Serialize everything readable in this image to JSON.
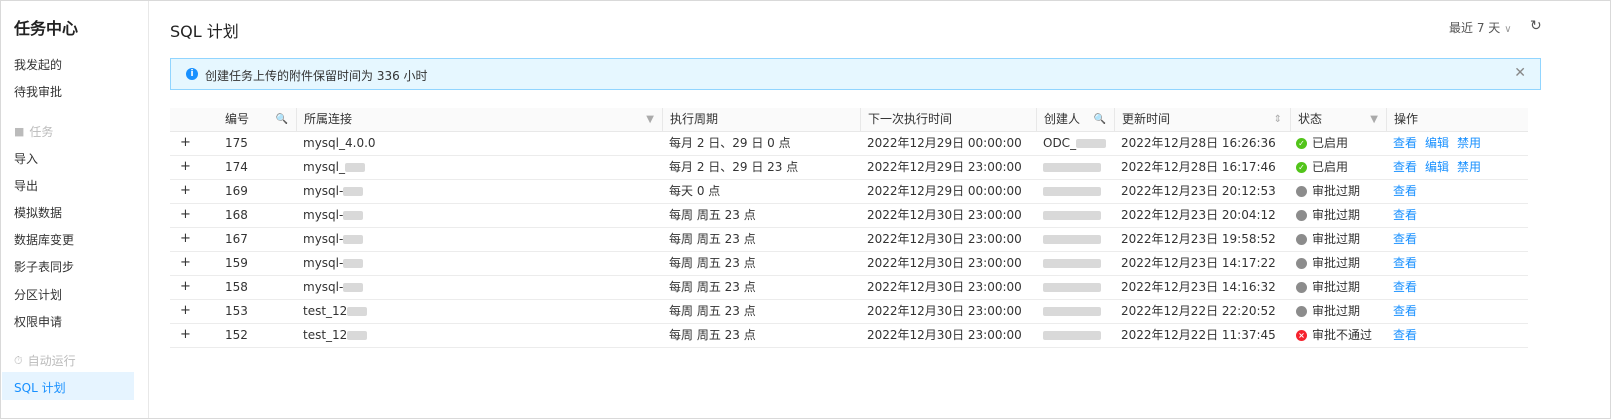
{
  "sidebar": {
    "title": "任务中心",
    "items_top": [
      "我发起的",
      "待我审批"
    ],
    "group_tasks": "任务",
    "task_items": [
      "导入",
      "导出",
      "模拟数据",
      "数据库变更",
      "影子表同步",
      "分区计划",
      "权限申请"
    ],
    "group_auto": "自动运行",
    "active_item": "SQL 计划"
  },
  "header": {
    "title": "SQL 计划",
    "range_label": "最近 7 天"
  },
  "alert": {
    "message": "创建任务上传的附件保留时间为 336 小时"
  },
  "table": {
    "columns": [
      "编号",
      "所属连接",
      "执行周期",
      "下一次执行时间",
      "创建人",
      "更新时间",
      "状态",
      "操作"
    ],
    "rows": [
      {
        "id": "175",
        "conn": "mysql_4.0.0",
        "cycle": "每月 2 日、29 日 0 点",
        "next": "2022年12月29日 00:00:00",
        "creator": "ODC_",
        "updated": "2022年12月28日 16:26:36",
        "status": "已启用",
        "status_type": "ok",
        "actions": [
          "查看",
          "编辑",
          "禁用"
        ]
      },
      {
        "id": "174",
        "conn": "mysql_",
        "cycle": "每月 2 日、29 日 23 点",
        "next": "2022年12月29日 23:00:00",
        "creator": "",
        "updated": "2022年12月28日 16:17:46",
        "status": "已启用",
        "status_type": "ok",
        "actions": [
          "查看",
          "编辑",
          "禁用"
        ]
      },
      {
        "id": "169",
        "conn": "mysql-",
        "cycle": "每天 0 点",
        "next": "2022年12月29日 00:00:00",
        "creator": "",
        "updated": "2022年12月23日 20:12:53",
        "status": "审批过期",
        "status_type": "expired",
        "actions": [
          "查看"
        ]
      },
      {
        "id": "168",
        "conn": "mysql-",
        "cycle": "每周 周五 23 点",
        "next": "2022年12月30日 23:00:00",
        "creator": "",
        "updated": "2022年12月23日 20:04:12",
        "status": "审批过期",
        "status_type": "expired",
        "actions": [
          "查看"
        ]
      },
      {
        "id": "167",
        "conn": "mysql-",
        "cycle": "每周 周五 23 点",
        "next": "2022年12月30日 23:00:00",
        "creator": "",
        "updated": "2022年12月23日 19:58:52",
        "status": "审批过期",
        "status_type": "expired",
        "actions": [
          "查看"
        ]
      },
      {
        "id": "159",
        "conn": "mysql-",
        "cycle": "每周 周五 23 点",
        "next": "2022年12月30日 23:00:00",
        "creator": "",
        "updated": "2022年12月23日 14:17:22",
        "status": "审批过期",
        "status_type": "expired",
        "actions": [
          "查看"
        ]
      },
      {
        "id": "158",
        "conn": "mysql-",
        "cycle": "每周 周五 23 点",
        "next": "2022年12月30日 23:00:00",
        "creator": "",
        "updated": "2022年12月23日 14:16:32",
        "status": "审批过期",
        "status_type": "expired",
        "actions": [
          "查看"
        ]
      },
      {
        "id": "153",
        "conn": "test_12",
        "cycle": "每周 周五 23 点",
        "next": "2022年12月30日 23:00:00",
        "creator": "",
        "updated": "2022年12月22日 22:20:52",
        "status": "审批过期",
        "status_type": "expired",
        "actions": [
          "查看"
        ]
      },
      {
        "id": "152",
        "conn": "test_12",
        "cycle": "每周 周五 23 点",
        "next": "2022年12月30日 23:00:00",
        "creator": "",
        "updated": "2022年12月22日 11:37:45",
        "status": "审批不通过",
        "status_type": "rejected",
        "actions": [
          "查看"
        ]
      }
    ]
  },
  "colors": {
    "accent": "#1890ff",
    "ok": "#52c41a",
    "expired": "#8c8c8c",
    "rejected": "#f5222d"
  },
  "icons": {
    "search": "search-icon",
    "filter": "filter-icon",
    "sort": "sort-icon",
    "refresh": "refresh-icon",
    "close": "close-icon",
    "info": "info-icon"
  }
}
